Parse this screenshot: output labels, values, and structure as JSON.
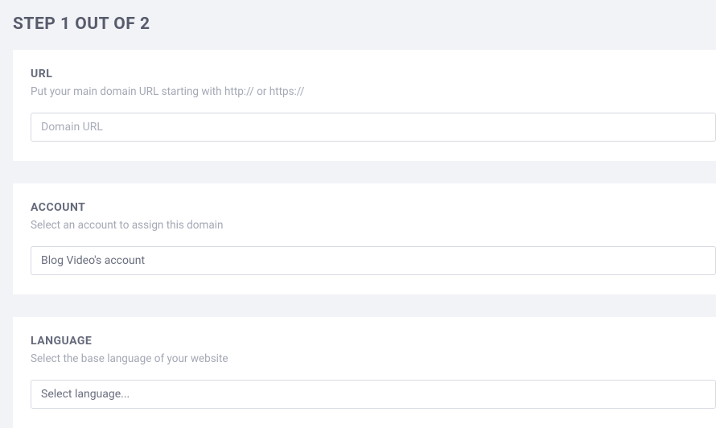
{
  "pageTitle": "STEP 1 OUT OF 2",
  "sections": {
    "url": {
      "label": "URL",
      "hint": "Put your main domain URL starting with http:// or https://",
      "placeholder": "Domain URL",
      "value": ""
    },
    "account": {
      "label": "ACCOUNT",
      "hint": "Select an account to assign this domain",
      "selected": "Blog Video's account"
    },
    "language": {
      "label": "LANGUAGE",
      "hint": "Select the base language of your website",
      "placeholder": "Select language..."
    }
  }
}
